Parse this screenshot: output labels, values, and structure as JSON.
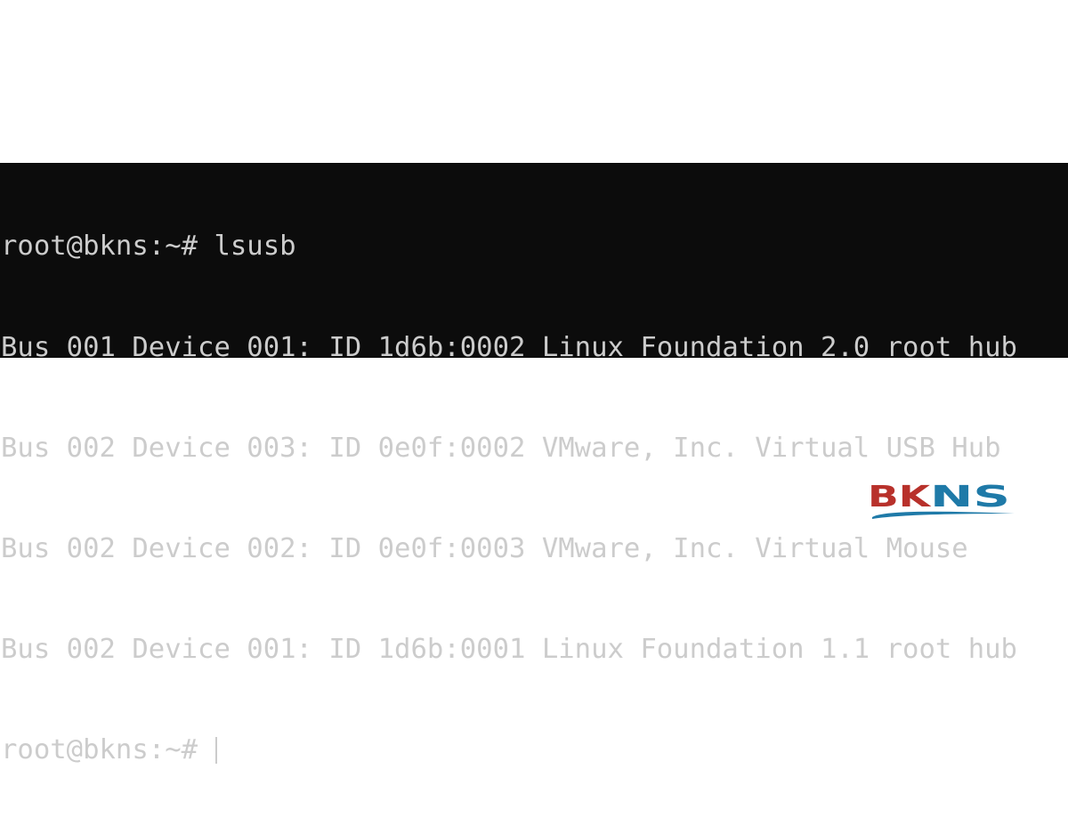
{
  "terminal": {
    "lines": [
      "root@bkns:~# lsusb",
      "Bus 001 Device 001: ID 1d6b:0002 Linux Foundation 2.0 root hub",
      "Bus 002 Device 003: ID 0e0f:0002 VMware, Inc. Virtual USB Hub",
      "Bus 002 Device 002: ID 0e0f:0003 VMware, Inc. Virtual Mouse",
      "Bus 002 Device 001: ID 1d6b:0001 Linux Foundation 1.1 root hub"
    ],
    "prompt": "root@bkns:~# "
  },
  "logo": {
    "text": "BKNS",
    "colors": {
      "bk": "#b8312b",
      "ns": "#1f7aa8"
    }
  },
  "colors": {
    "background": "#0c0c0c",
    "text": "#cccccc"
  }
}
